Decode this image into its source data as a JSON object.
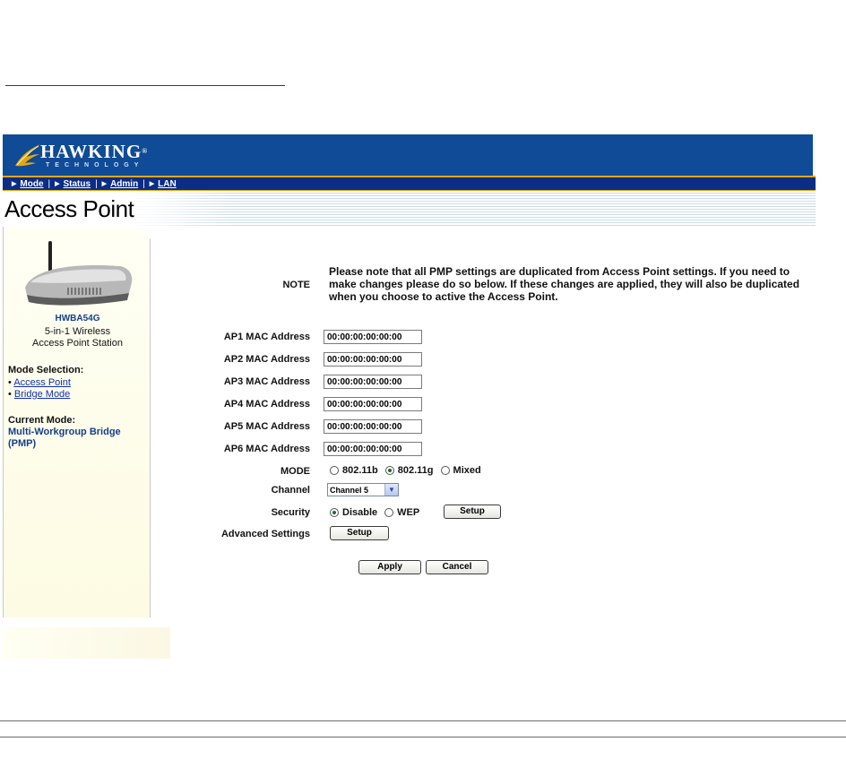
{
  "brand": {
    "name": "HAWKING",
    "reg": "®",
    "sub": "TECHNOLOGY",
    "accent": "#0f4b96",
    "nav_bg": "#0c2d86",
    "gold": "#e2a810"
  },
  "nav": {
    "items": [
      {
        "label": "Mode"
      },
      {
        "label": "Status"
      },
      {
        "label": "Admin"
      },
      {
        "label": "LAN"
      }
    ],
    "separator": "|"
  },
  "page_title": "Access Point",
  "sidebar": {
    "model": "HWBA54G",
    "desc_line1": "5-in-1 Wireless",
    "desc_line2": "Access Point Station",
    "mode_selection_label": "Mode Selection:",
    "mode_links": [
      {
        "label": "Access Point"
      },
      {
        "label": "Bridge Mode"
      }
    ],
    "current_mode_label": "Current Mode:",
    "current_mode_value": "Multi-Workgroup Bridge (PMP)"
  },
  "form": {
    "note_label": "NOTE",
    "note_text": "Please note that all PMP settings are duplicated from Access Point settings. If you need to make changes please do so below. If these changes are applied, they will also be duplicated when you choose to active the Access Point.",
    "mac_fields": [
      {
        "label": "AP1 MAC Address",
        "value": "00:00:00:00:00:00"
      },
      {
        "label": "AP2 MAC Address",
        "value": "00:00:00:00:00:00"
      },
      {
        "label": "AP3 MAC Address",
        "value": "00:00:00:00:00:00"
      },
      {
        "label": "AP4 MAC Address",
        "value": "00:00:00:00:00:00"
      },
      {
        "label": "AP5 MAC Address",
        "value": "00:00:00:00:00:00"
      },
      {
        "label": "AP6 MAC Address",
        "value": "00:00:00:00:00:00"
      }
    ],
    "mode_label": "MODE",
    "mode_options": [
      "802.11b",
      "802.11g",
      "Mixed"
    ],
    "mode_selected": "802.11g",
    "channel_label": "Channel",
    "channel_value": "Channel 5",
    "security_label": "Security",
    "security_options": [
      "Disable",
      "WEP"
    ],
    "security_selected": "Disable",
    "security_setup_label": "Setup",
    "advanced_label": "Advanced Settings",
    "advanced_setup_label": "Setup",
    "apply_label": "Apply",
    "cancel_label": "Cancel"
  }
}
